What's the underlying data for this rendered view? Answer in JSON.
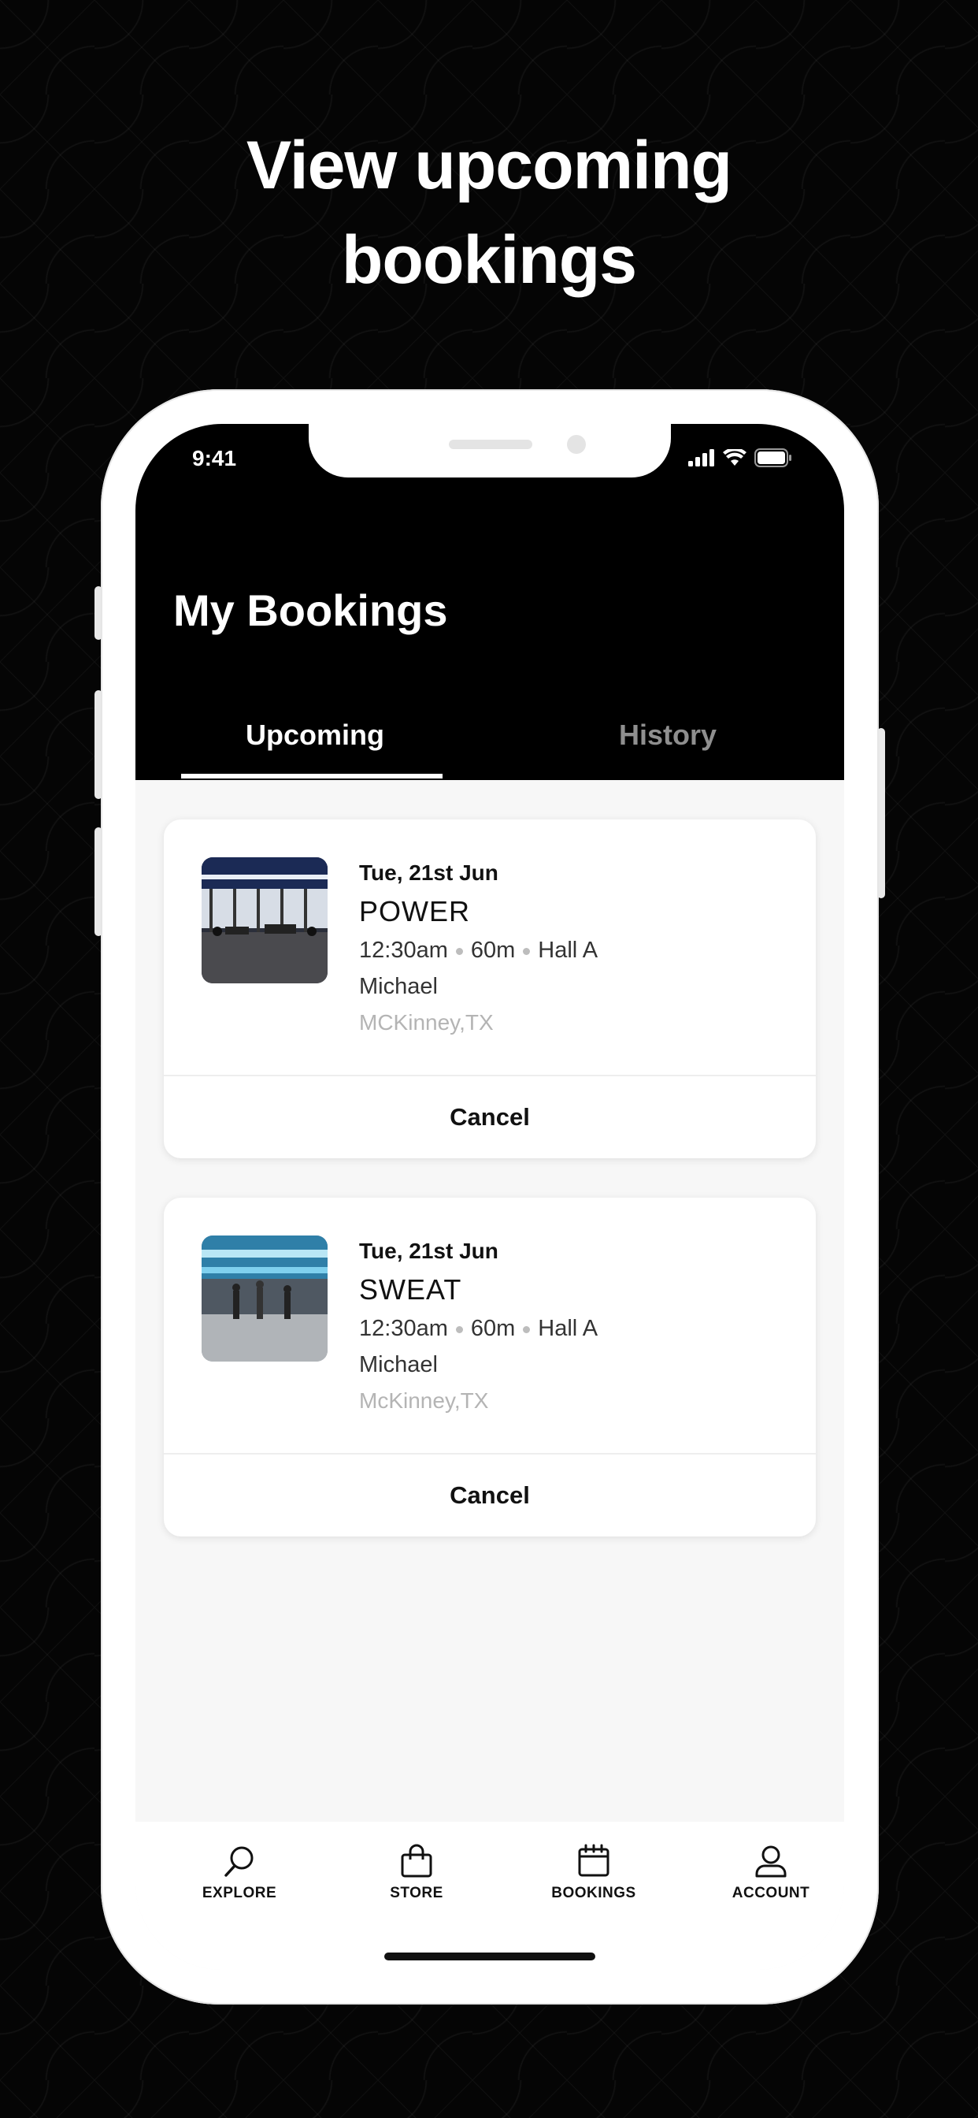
{
  "headline": {
    "line1": "View upcoming",
    "line2": "bookings"
  },
  "status_bar": {
    "time": "9:41"
  },
  "header": {
    "title": "My Bookings"
  },
  "tabs": {
    "upcoming": "Upcoming",
    "history": "History"
  },
  "bookings": [
    {
      "date": "Tue, 21st Jun",
      "class_name": "POWER",
      "time": "12:30am",
      "duration": "60m",
      "room": "Hall A",
      "trainer": "Michael",
      "location": "MCKinney,TX",
      "cancel_label": "Cancel"
    },
    {
      "date": "Tue, 21st Jun",
      "class_name": "SWEAT",
      "time": "12:30am",
      "duration": "60m",
      "room": "Hall A",
      "trainer": "Michael",
      "location": "McKinney,TX",
      "cancel_label": "Cancel"
    }
  ],
  "tabbar": [
    {
      "label": "EXPLORE",
      "icon": "search-icon"
    },
    {
      "label": "STORE",
      "icon": "shopping-bag-icon"
    },
    {
      "label": "BOOKINGS",
      "icon": "calendar-icon"
    },
    {
      "label": "ACCOUNT",
      "icon": "user-icon"
    }
  ]
}
